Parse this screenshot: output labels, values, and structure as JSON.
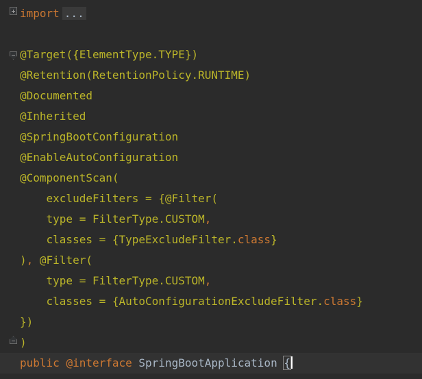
{
  "code": {
    "l1_import": "import",
    "l1_folded": "...",
    "l3": "@Target({ElementType.TYPE})",
    "l4": "@Retention(RetentionPolicy.RUNTIME)",
    "l5": "@Documented",
    "l6": "@Inherited",
    "l7": "@SpringBootConfiguration",
    "l8": "@EnableAutoConfiguration",
    "l9": "@ComponentScan(",
    "l10": "    excludeFilters = {@Filter(",
    "l11_a": "    type = FilterType.CUSTOM",
    "l11_b": ",",
    "l12_a": "    classes = {TypeExcludeFilter.",
    "l12_b": "class",
    "l12_c": "}",
    "l13_a": ")",
    "l13_b": ", ",
    "l13_c": "@Filter(",
    "l14_a": "    type = FilterType.CUSTOM",
    "l14_b": ",",
    "l15_a": "    classes = {AutoConfigurationExcludeFilter.",
    "l15_b": "class",
    "l15_c": "}",
    "l16": "})",
    "l17": ")",
    "l18_public": "public",
    "l18_interface": "@interface",
    "l18_name": "SpringBootApplication",
    "l18_brace": "{"
  },
  "colors": {
    "background": "#2b2b2b",
    "keyword": "#cc7832",
    "annotation": "#bbb529",
    "text": "#a9b7c6"
  }
}
